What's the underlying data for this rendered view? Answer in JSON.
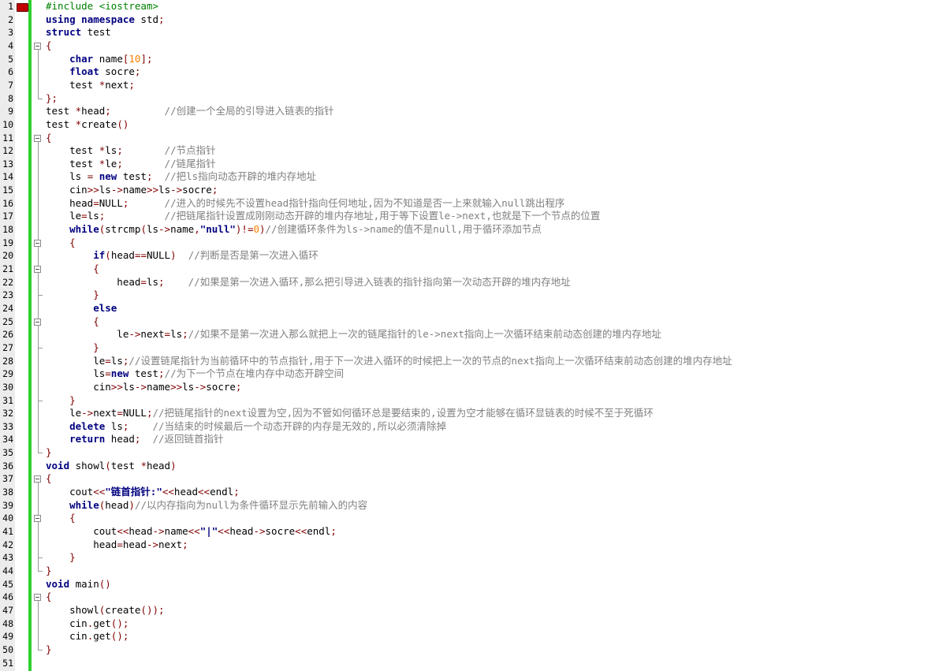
{
  "editor": {
    "colors": {
      "keyword": "#000080",
      "preprocessor": "#008000",
      "comment": "#808080",
      "number": "#ff8000",
      "operator": "#800000",
      "change_bar": "#2fd12f",
      "breakpoint": "#c00000"
    },
    "line_numbers": [
      "1",
      "2",
      "3",
      "4",
      "5",
      "6",
      "7",
      "8",
      "9",
      "10",
      "11",
      "12",
      "13",
      "14",
      "15",
      "16",
      "17",
      "18",
      "19",
      "20",
      "21",
      "22",
      "23",
      "24",
      "25",
      "26",
      "27",
      "28",
      "29",
      "30",
      "31",
      "32",
      "33",
      "34",
      "35",
      "36",
      "37",
      "38",
      "39",
      "40",
      "41",
      "42",
      "43",
      "44",
      "45",
      "46",
      "47",
      "48",
      "49",
      "50",
      "51"
    ],
    "lines": [
      [
        [
          "pp",
          "#include <iostream>"
        ]
      ],
      [
        [
          "kw",
          "using"
        ],
        [
          "id",
          " "
        ],
        [
          "kw",
          "namespace"
        ],
        [
          "id",
          " std"
        ],
        [
          "op",
          ";"
        ]
      ],
      [
        [
          "kw",
          "struct"
        ],
        [
          "id",
          " test"
        ]
      ],
      [
        [
          "op",
          "{"
        ]
      ],
      [
        [
          "id",
          "    "
        ],
        [
          "kw",
          "char"
        ],
        [
          "id",
          " name"
        ],
        [
          "op",
          "["
        ],
        [
          "num",
          "10"
        ],
        [
          "op",
          "];"
        ]
      ],
      [
        [
          "id",
          "    "
        ],
        [
          "kw",
          "float"
        ],
        [
          "id",
          " socre"
        ],
        [
          "op",
          ";"
        ]
      ],
      [
        [
          "id",
          "    test "
        ],
        [
          "op",
          "*"
        ],
        [
          "id",
          "next"
        ],
        [
          "op",
          ";"
        ]
      ],
      [
        [
          "op",
          "};"
        ]
      ],
      [
        [
          "id",
          "test "
        ],
        [
          "op",
          "*"
        ],
        [
          "id",
          "head"
        ],
        [
          "op",
          ";"
        ],
        [
          "id",
          "         "
        ],
        [
          "cm",
          "//创建一个全局的引导进入链表的指针"
        ]
      ],
      [
        [
          "id",
          "test "
        ],
        [
          "op",
          "*"
        ],
        [
          "id",
          "create"
        ],
        [
          "op",
          "()"
        ]
      ],
      [
        [
          "op",
          "{"
        ]
      ],
      [
        [
          "id",
          "    test "
        ],
        [
          "op",
          "*"
        ],
        [
          "id",
          "ls"
        ],
        [
          "op",
          ";"
        ],
        [
          "id",
          "       "
        ],
        [
          "cm",
          "//节点指针"
        ]
      ],
      [
        [
          "id",
          "    test "
        ],
        [
          "op",
          "*"
        ],
        [
          "id",
          "le"
        ],
        [
          "op",
          ";"
        ],
        [
          "id",
          "       "
        ],
        [
          "cm",
          "//链尾指针"
        ]
      ],
      [
        [
          "id",
          "    ls "
        ],
        [
          "op",
          "="
        ],
        [
          "id",
          " "
        ],
        [
          "kw",
          "new"
        ],
        [
          "id",
          " test"
        ],
        [
          "op",
          ";"
        ],
        [
          "id",
          "  "
        ],
        [
          "cm",
          "//把ls指向动态开辟的堆内存地址"
        ]
      ],
      [
        [
          "id",
          "    cin"
        ],
        [
          "op",
          ">>"
        ],
        [
          "id",
          "ls"
        ],
        [
          "op",
          "->"
        ],
        [
          "id",
          "name"
        ],
        [
          "op",
          ">>"
        ],
        [
          "id",
          "ls"
        ],
        [
          "op",
          "->"
        ],
        [
          "id",
          "socre"
        ],
        [
          "op",
          ";"
        ]
      ],
      [
        [
          "id",
          "    head"
        ],
        [
          "op",
          "="
        ],
        [
          "id",
          "NULL"
        ],
        [
          "op",
          ";"
        ],
        [
          "id",
          "      "
        ],
        [
          "cm",
          "//进入的时候先不设置head指针指向任何地址,因为不知道是否一上来就输入null跳出程序"
        ]
      ],
      [
        [
          "id",
          "    le"
        ],
        [
          "op",
          "="
        ],
        [
          "id",
          "ls"
        ],
        [
          "op",
          ";"
        ],
        [
          "id",
          "          "
        ],
        [
          "cm",
          "//把链尾指针设置成刚刚动态开辟的堆内存地址,用于等下设置le->next,也就是下一个节点的位置"
        ]
      ],
      [
        [
          "id",
          "    "
        ],
        [
          "kw",
          "while"
        ],
        [
          "op",
          "("
        ],
        [
          "id",
          "strcmp"
        ],
        [
          "op",
          "("
        ],
        [
          "id",
          "ls"
        ],
        [
          "op",
          "->"
        ],
        [
          "id",
          "name"
        ],
        [
          "op",
          ","
        ],
        [
          "str",
          "\"null\""
        ],
        [
          "op",
          ")!="
        ],
        [
          "num",
          "0"
        ],
        [
          "op",
          ")"
        ],
        [
          "cm",
          "//创建循环条件为ls->name的值不是null,用于循环添加节点"
        ]
      ],
      [
        [
          "id",
          "    "
        ],
        [
          "op",
          "{"
        ]
      ],
      [
        [
          "id",
          "        "
        ],
        [
          "kw",
          "if"
        ],
        [
          "op",
          "("
        ],
        [
          "id",
          "head"
        ],
        [
          "op",
          "=="
        ],
        [
          "id",
          "NULL"
        ],
        [
          "op",
          ")"
        ],
        [
          "id",
          "  "
        ],
        [
          "cm",
          "//判断是否是第一次进入循环"
        ]
      ],
      [
        [
          "id",
          "        "
        ],
        [
          "op",
          "{"
        ]
      ],
      [
        [
          "id",
          "            head"
        ],
        [
          "op",
          "="
        ],
        [
          "id",
          "ls"
        ],
        [
          "op",
          ";"
        ],
        [
          "id",
          "    "
        ],
        [
          "cm",
          "//如果是第一次进入循环,那么把引导进入链表的指针指向第一次动态开辟的堆内存地址"
        ]
      ],
      [
        [
          "id",
          "        "
        ],
        [
          "op",
          "}"
        ]
      ],
      [
        [
          "id",
          "        "
        ],
        [
          "kw",
          "else"
        ]
      ],
      [
        [
          "id",
          "        "
        ],
        [
          "op",
          "{"
        ]
      ],
      [
        [
          "id",
          "            le"
        ],
        [
          "op",
          "->"
        ],
        [
          "id",
          "next"
        ],
        [
          "op",
          "="
        ],
        [
          "id",
          "ls"
        ],
        [
          "op",
          ";"
        ],
        [
          "cm",
          "//如果不是第一次进入那么就把上一次的链尾指针的le->next指向上一次循环结束前动态创建的堆内存地址"
        ]
      ],
      [
        [
          "id",
          "        "
        ],
        [
          "op",
          "}"
        ]
      ],
      [
        [
          "id",
          "        le"
        ],
        [
          "op",
          "="
        ],
        [
          "id",
          "ls"
        ],
        [
          "op",
          ";"
        ],
        [
          "cm",
          "//设置链尾指针为当前循环中的节点指针,用于下一次进入循环的时候把上一次的节点的next指向上一次循环结束前动态创建的堆内存地址"
        ]
      ],
      [
        [
          "id",
          "        ls"
        ],
        [
          "op",
          "="
        ],
        [
          "kw",
          "new"
        ],
        [
          "id",
          " test"
        ],
        [
          "op",
          ";"
        ],
        [
          "cm",
          "//为下一个节点在堆内存中动态开辟空间"
        ]
      ],
      [
        [
          "id",
          "        cin"
        ],
        [
          "op",
          ">>"
        ],
        [
          "id",
          "ls"
        ],
        [
          "op",
          "->"
        ],
        [
          "id",
          "name"
        ],
        [
          "op",
          ">>"
        ],
        [
          "id",
          "ls"
        ],
        [
          "op",
          "->"
        ],
        [
          "id",
          "socre"
        ],
        [
          "op",
          ";"
        ]
      ],
      [
        [
          "id",
          "    "
        ],
        [
          "op",
          "}"
        ]
      ],
      [
        [
          "id",
          "    le"
        ],
        [
          "op",
          "->"
        ],
        [
          "id",
          "next"
        ],
        [
          "op",
          "="
        ],
        [
          "id",
          "NULL"
        ],
        [
          "op",
          ";"
        ],
        [
          "cm",
          "//把链尾指针的next设置为空,因为不管如何循环总是要结束的,设置为空才能够在循环显链表的时候不至于死循环"
        ]
      ],
      [
        [
          "id",
          "    "
        ],
        [
          "kw",
          "delete"
        ],
        [
          "id",
          " ls"
        ],
        [
          "op",
          ";"
        ],
        [
          "id",
          "    "
        ],
        [
          "cm",
          "//当结束的时候最后一个动态开辟的内存是无效的,所以必须清除掉"
        ]
      ],
      [
        [
          "id",
          "    "
        ],
        [
          "kw",
          "return"
        ],
        [
          "id",
          " head"
        ],
        [
          "op",
          ";"
        ],
        [
          "id",
          "  "
        ],
        [
          "cm",
          "//返回链首指针"
        ]
      ],
      [
        [
          "op",
          "}"
        ]
      ],
      [
        [
          "kw",
          "void"
        ],
        [
          "id",
          " showl"
        ],
        [
          "op",
          "("
        ],
        [
          "id",
          "test "
        ],
        [
          "op",
          "*"
        ],
        [
          "id",
          "head"
        ],
        [
          "op",
          ")"
        ]
      ],
      [
        [
          "op",
          "{"
        ]
      ],
      [
        [
          "id",
          "    cout"
        ],
        [
          "op",
          "<<"
        ],
        [
          "str",
          "\"链首指针:\""
        ],
        [
          "op",
          "<<"
        ],
        [
          "id",
          "head"
        ],
        [
          "op",
          "<<"
        ],
        [
          "id",
          "endl"
        ],
        [
          "op",
          ";"
        ]
      ],
      [
        [
          "id",
          "    "
        ],
        [
          "kw",
          "while"
        ],
        [
          "op",
          "("
        ],
        [
          "id",
          "head"
        ],
        [
          "op",
          ")"
        ],
        [
          "cm",
          "//以内存指向为null为条件循环显示先前输入的内容"
        ]
      ],
      [
        [
          "id",
          "    "
        ],
        [
          "op",
          "{"
        ]
      ],
      [
        [
          "id",
          "        cout"
        ],
        [
          "op",
          "<<"
        ],
        [
          "id",
          "head"
        ],
        [
          "op",
          "->"
        ],
        [
          "id",
          "name"
        ],
        [
          "op",
          "<<"
        ],
        [
          "str",
          "\"|\""
        ],
        [
          "op",
          "<<"
        ],
        [
          "id",
          "head"
        ],
        [
          "op",
          "->"
        ],
        [
          "id",
          "socre"
        ],
        [
          "op",
          "<<"
        ],
        [
          "id",
          "endl"
        ],
        [
          "op",
          ";"
        ]
      ],
      [
        [
          "id",
          "        head"
        ],
        [
          "op",
          "="
        ],
        [
          "id",
          "head"
        ],
        [
          "op",
          "->"
        ],
        [
          "id",
          "next"
        ],
        [
          "op",
          ";"
        ]
      ],
      [
        [
          "id",
          "    "
        ],
        [
          "op",
          "}"
        ]
      ],
      [
        [
          "op",
          "}"
        ]
      ],
      [
        [
          "kw",
          "void"
        ],
        [
          "id",
          " main"
        ],
        [
          "op",
          "()"
        ]
      ],
      [
        [
          "op",
          "{"
        ]
      ],
      [
        [
          "id",
          "    showl"
        ],
        [
          "op",
          "("
        ],
        [
          "id",
          "create"
        ],
        [
          "op",
          "());"
        ]
      ],
      [
        [
          "id",
          "    cin"
        ],
        [
          "op",
          "."
        ],
        [
          "id",
          "get"
        ],
        [
          "op",
          "();"
        ]
      ],
      [
        [
          "id",
          "    cin"
        ],
        [
          "op",
          "."
        ],
        [
          "id",
          "get"
        ],
        [
          "op",
          "();"
        ]
      ],
      [
        [
          "op",
          "}"
        ]
      ],
      [
        [
          "id",
          ""
        ]
      ]
    ]
  }
}
